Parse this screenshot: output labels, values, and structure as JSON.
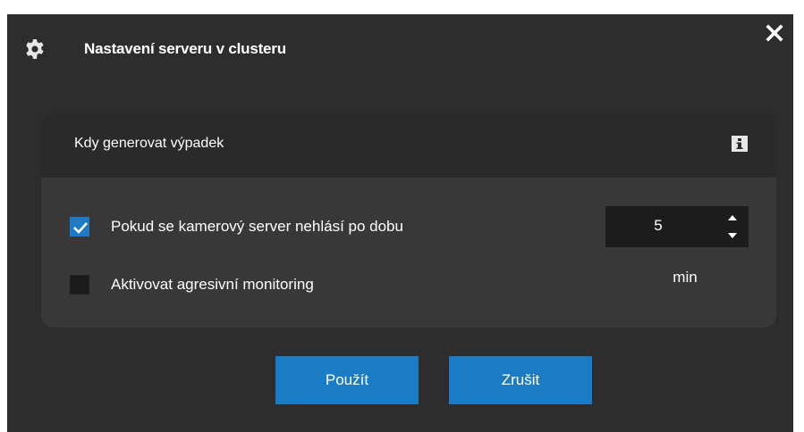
{
  "dialog": {
    "title": "Nastavení serveru v clusteru",
    "title_icon": "gear-icon",
    "close_icon": "close-icon"
  },
  "panel": {
    "title": "Kdy generovat výpadek",
    "info_icon": "info-icon",
    "options": [
      {
        "label": "Pokud se kamerový server nehlásí po dobu",
        "checked": true
      },
      {
        "label": "Aktivovat agresivní monitoring",
        "checked": false
      }
    ],
    "timeout": {
      "value": "5",
      "unit": "min"
    }
  },
  "buttons": {
    "apply": "Použít",
    "cancel": "Zrušit"
  },
  "colors": {
    "background": "#2d2d2d",
    "panel": "#383838",
    "accent": "#1a7cc4"
  }
}
